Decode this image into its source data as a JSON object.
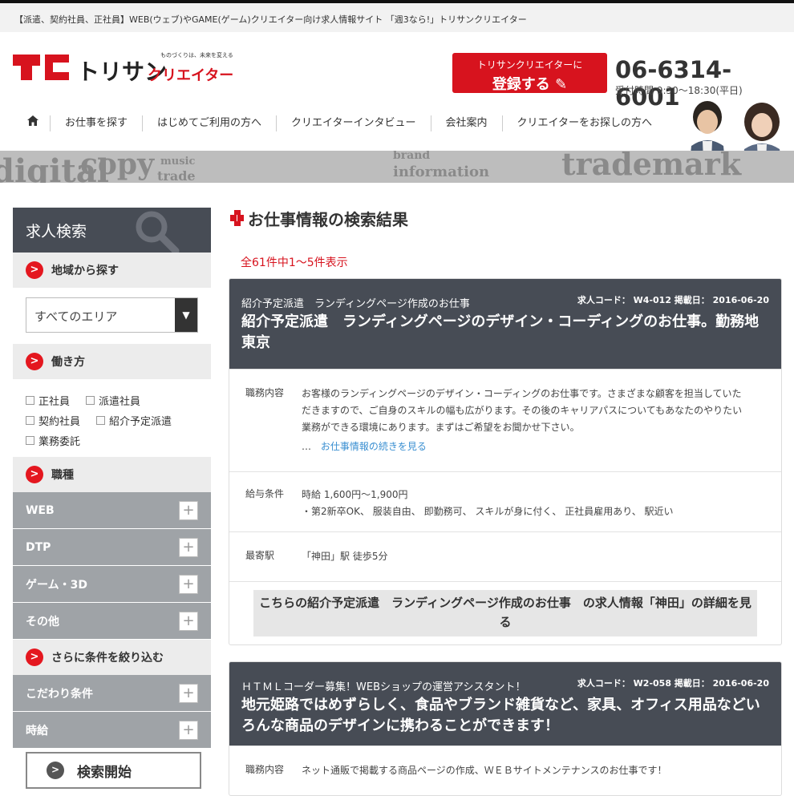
{
  "topbar": {
    "text": "【派遣、契約社員、正社員】WEB(ウェブ)やGAME(ゲーム)クリエイター向け求人情報サイト 「週3なら!」トリサンクリエイター"
  },
  "header": {
    "logo_text": "トリサン",
    "logo_sub": "クリエイター",
    "logo_tagline": "ものづくりは、未来を変える",
    "register_line1": "トリサンクリエイターに",
    "register_line2": "登録する",
    "phone": "06-6314-6001",
    "hours": "受付時間 9:30〜18:30(平日)"
  },
  "nav": {
    "items": [
      "お仕事を探す",
      "はじめてご利用の方へ",
      "クリエイターインタビュー",
      "会社案内",
      "クリエイターをお探しの方へ"
    ]
  },
  "banner": {
    "words": [
      "copy",
      "music",
      "trade",
      "brand",
      "information",
      "trademark",
      "digital"
    ]
  },
  "sidebar": {
    "title": "求人検索",
    "area_heading": "地域から探す",
    "area_selected": "すべてのエリア",
    "work_heading": "働き方",
    "work_options": [
      "正社員",
      "派遣社員",
      "契約社員",
      "紹介予定派遣",
      "業務委託"
    ],
    "job_heading": "職種",
    "job_categories": [
      "WEB",
      "DTP",
      "ゲーム・3D",
      "その他"
    ],
    "narrow_heading": "さらに条件を絞り込む",
    "narrow_categories": [
      "こだわり条件",
      "時給"
    ],
    "search_button": "検索開始"
  },
  "main": {
    "title": "お仕事情報の検索結果",
    "count": "全61件中1〜5件表示",
    "jobs": [
      {
        "subtitle": "紹介予定派遣　ランディングページ作成のお仕事",
        "meta": "求人コード： W4-012  掲載日： 2016-06-20",
        "title": "紹介予定派遣　ランディングページのデザイン・コーディングのお仕事。勤務地　東京",
        "duty_label": "職務内容",
        "duty": "お客様のランディングページのデザイン・コーディングのお仕事です。さまざまな顧客を担当していただきますので、ご自身のスキルの幅も広がります。その後のキャリアパスについてもあなたのやりたい業務ができる環境にあります。まずはご希望をお聞かせ下さい。",
        "ellipsis": "…",
        "more": "お仕事情報の続きを見る",
        "salary_label": "給与条件",
        "salary": "時給 1,600円〜1,900円",
        "perks": "・第2新卒OK、 服装自由、 即勤務可、 スキルが身に付く、 正社員雇用あり、 駅近い",
        "station_label": "最寄駅",
        "station": "「神田」駅 徒歩5分",
        "detail": "こちらの紹介予定派遣　ランディングページ作成のお仕事　の求人情報「神田」の詳細を見る"
      },
      {
        "subtitle": "ＨＴＭＬコーダー募集！WEBショップの運営アシスタント！",
        "meta": "求人コード： W2-058  掲載日： 2016-06-20",
        "title": "地元姫路ではめずらしく、食品やブランド雑貨など、家具、オフィス用品などいろんな商品のデザインに携わることができます！",
        "duty_label": "職務内容",
        "duty": "ネット通販で掲載する商品ページの作成、ＷＥＢサイトメンテナンスのお仕事です！"
      }
    ]
  },
  "colors": {
    "accent": "#d7131e",
    "dark": "#474c55",
    "gray": "#9fa3a7"
  }
}
